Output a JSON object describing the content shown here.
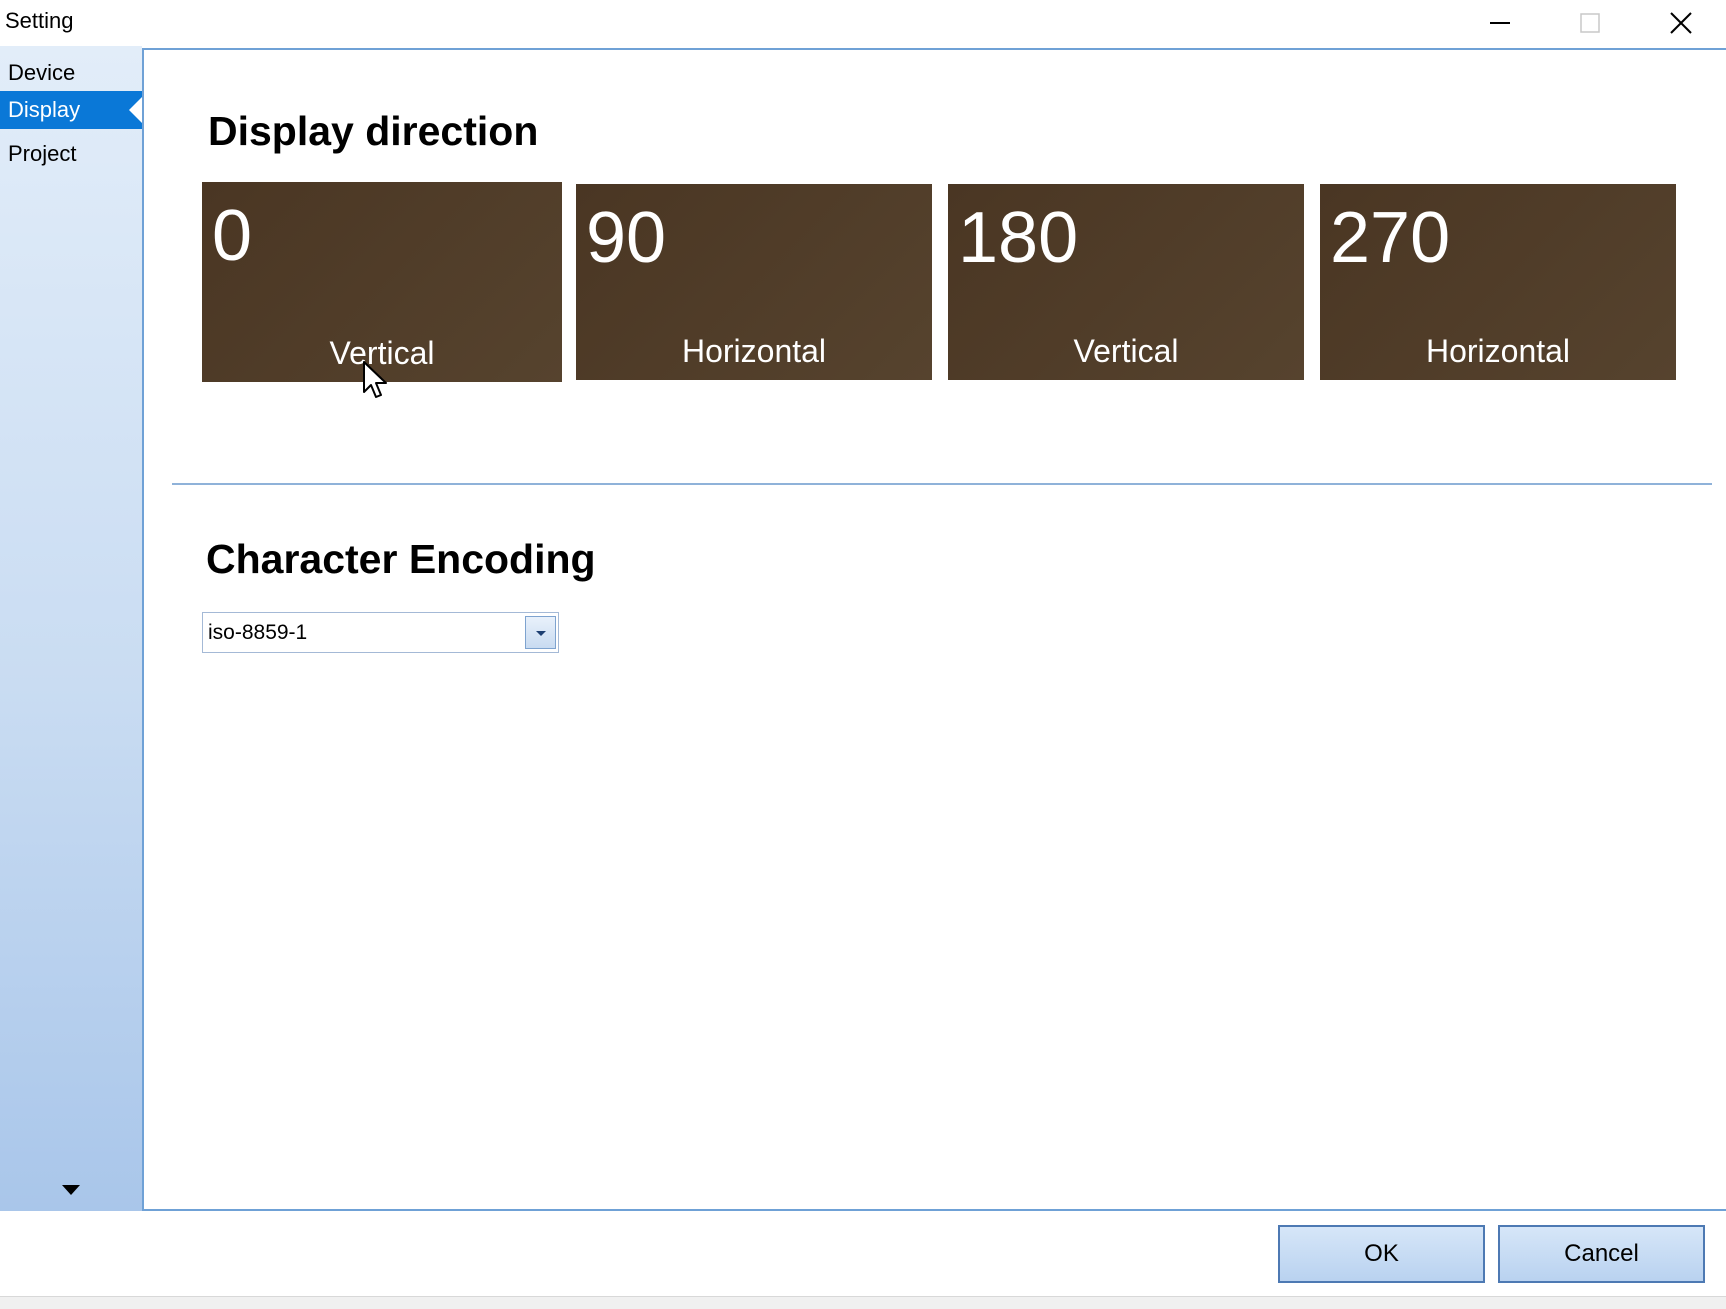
{
  "window": {
    "title": "Setting",
    "controls": [
      "minimize-icon",
      "maximize-icon",
      "close-icon"
    ]
  },
  "sidebar": {
    "items": [
      {
        "label": "Device",
        "active": false
      },
      {
        "label": "Display",
        "active": true
      },
      {
        "label": "Project",
        "active": false
      }
    ],
    "scroll_icon": "chevron-down-icon"
  },
  "display_direction": {
    "title": "Display direction",
    "tiles": [
      {
        "degree": "0",
        "label": "Vertical"
      },
      {
        "degree": "90",
        "label": "Horizontal"
      },
      {
        "degree": "180",
        "label": "Vertical"
      },
      {
        "degree": "270",
        "label": "Horizontal"
      }
    ]
  },
  "character_encoding": {
    "title": "Character Encoding",
    "selected": "iso-8859-1"
  },
  "buttons": {
    "ok": "OK",
    "cancel": "Cancel"
  },
  "colors": {
    "tile_bg": "#4e3b28",
    "active_nav": "#0a78d7",
    "accent_border": "#6fa1d6"
  }
}
